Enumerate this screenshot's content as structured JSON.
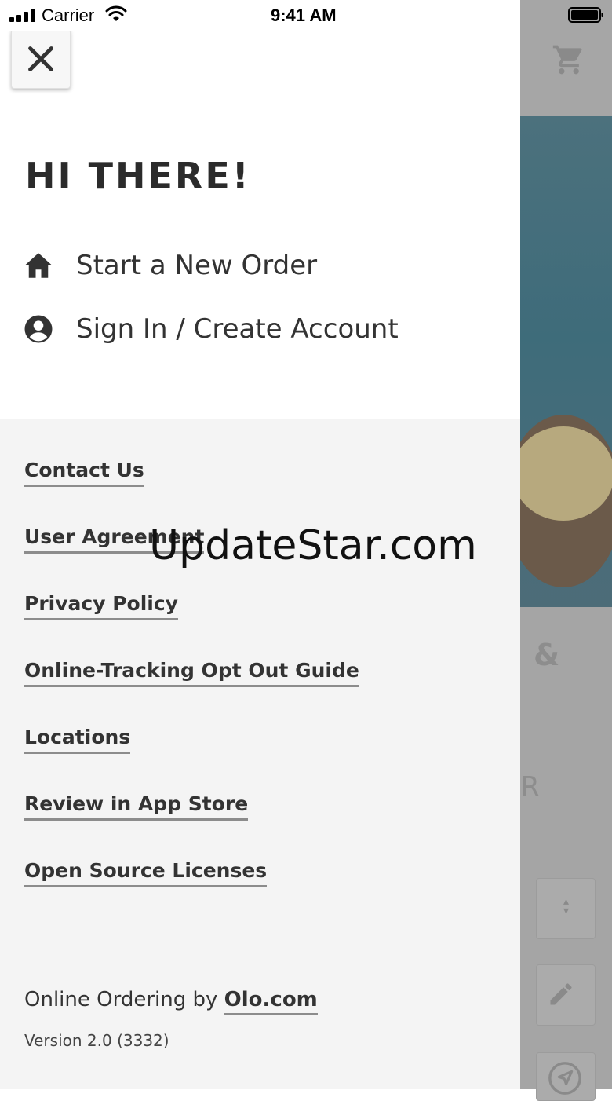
{
  "status_bar": {
    "carrier": "Carrier",
    "time": "9:41 AM"
  },
  "drawer": {
    "greeting": "HI THERE!",
    "menu": [
      {
        "icon": "home-icon",
        "label": "Start a New Order"
      },
      {
        "icon": "account-icon",
        "label": "Sign In / Create Account"
      }
    ],
    "footer_links": [
      "Contact Us",
      "User Agreement",
      "Privacy Policy",
      "Online-Tracking Opt Out Guide",
      "Locations",
      "Review in App Store",
      "Open Source Licenses"
    ],
    "credit_prefix": "Online Ordering by",
    "credit_link": "Olo.com",
    "version": "Version 2.0 (3332)"
  },
  "background": {
    "amp": "&",
    "r_fragment": "R"
  },
  "watermark": "UpdateStar.com",
  "colors": {
    "drawer_bg": "#ffffff",
    "footer_bg": "#f4f4f4",
    "text": "#333333",
    "overlay": "#9a9a9a"
  },
  "icons": [
    "close-icon",
    "home-icon",
    "account-icon",
    "cart-icon",
    "pencil-icon",
    "navigation-icon"
  ]
}
